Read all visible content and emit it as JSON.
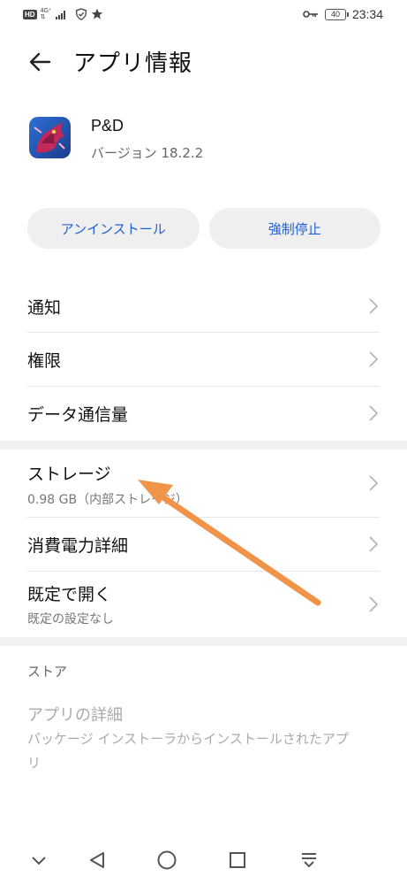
{
  "status_bar": {
    "hd": "HD",
    "network": "4G⁺",
    "network_sub": "⇅",
    "battery": "40",
    "time": "23:34"
  },
  "title_bar": {
    "title": "アプリ情報"
  },
  "app": {
    "name": "P&D",
    "version": "バージョン 18.2.2"
  },
  "actions": {
    "uninstall": "アンインストール",
    "force_stop": "強制停止"
  },
  "menu": {
    "notifications": "通知",
    "permissions": "権限",
    "data_usage": "データ通信量",
    "storage": {
      "label": "ストレージ",
      "sub": "0.98 GB（内部ストレージ）"
    },
    "battery": "消費電力詳細",
    "open_by_default": {
      "label": "既定で開く",
      "sub": "既定の設定なし"
    }
  },
  "store": {
    "section": "ストア",
    "title": "アプリの詳細",
    "desc": "パッケージ インストーラからインストールされたアプリ"
  },
  "colors": {
    "accent": "#1f5fd6",
    "annotation_arrow": "#f0944a",
    "band": "#f1f1f1"
  }
}
